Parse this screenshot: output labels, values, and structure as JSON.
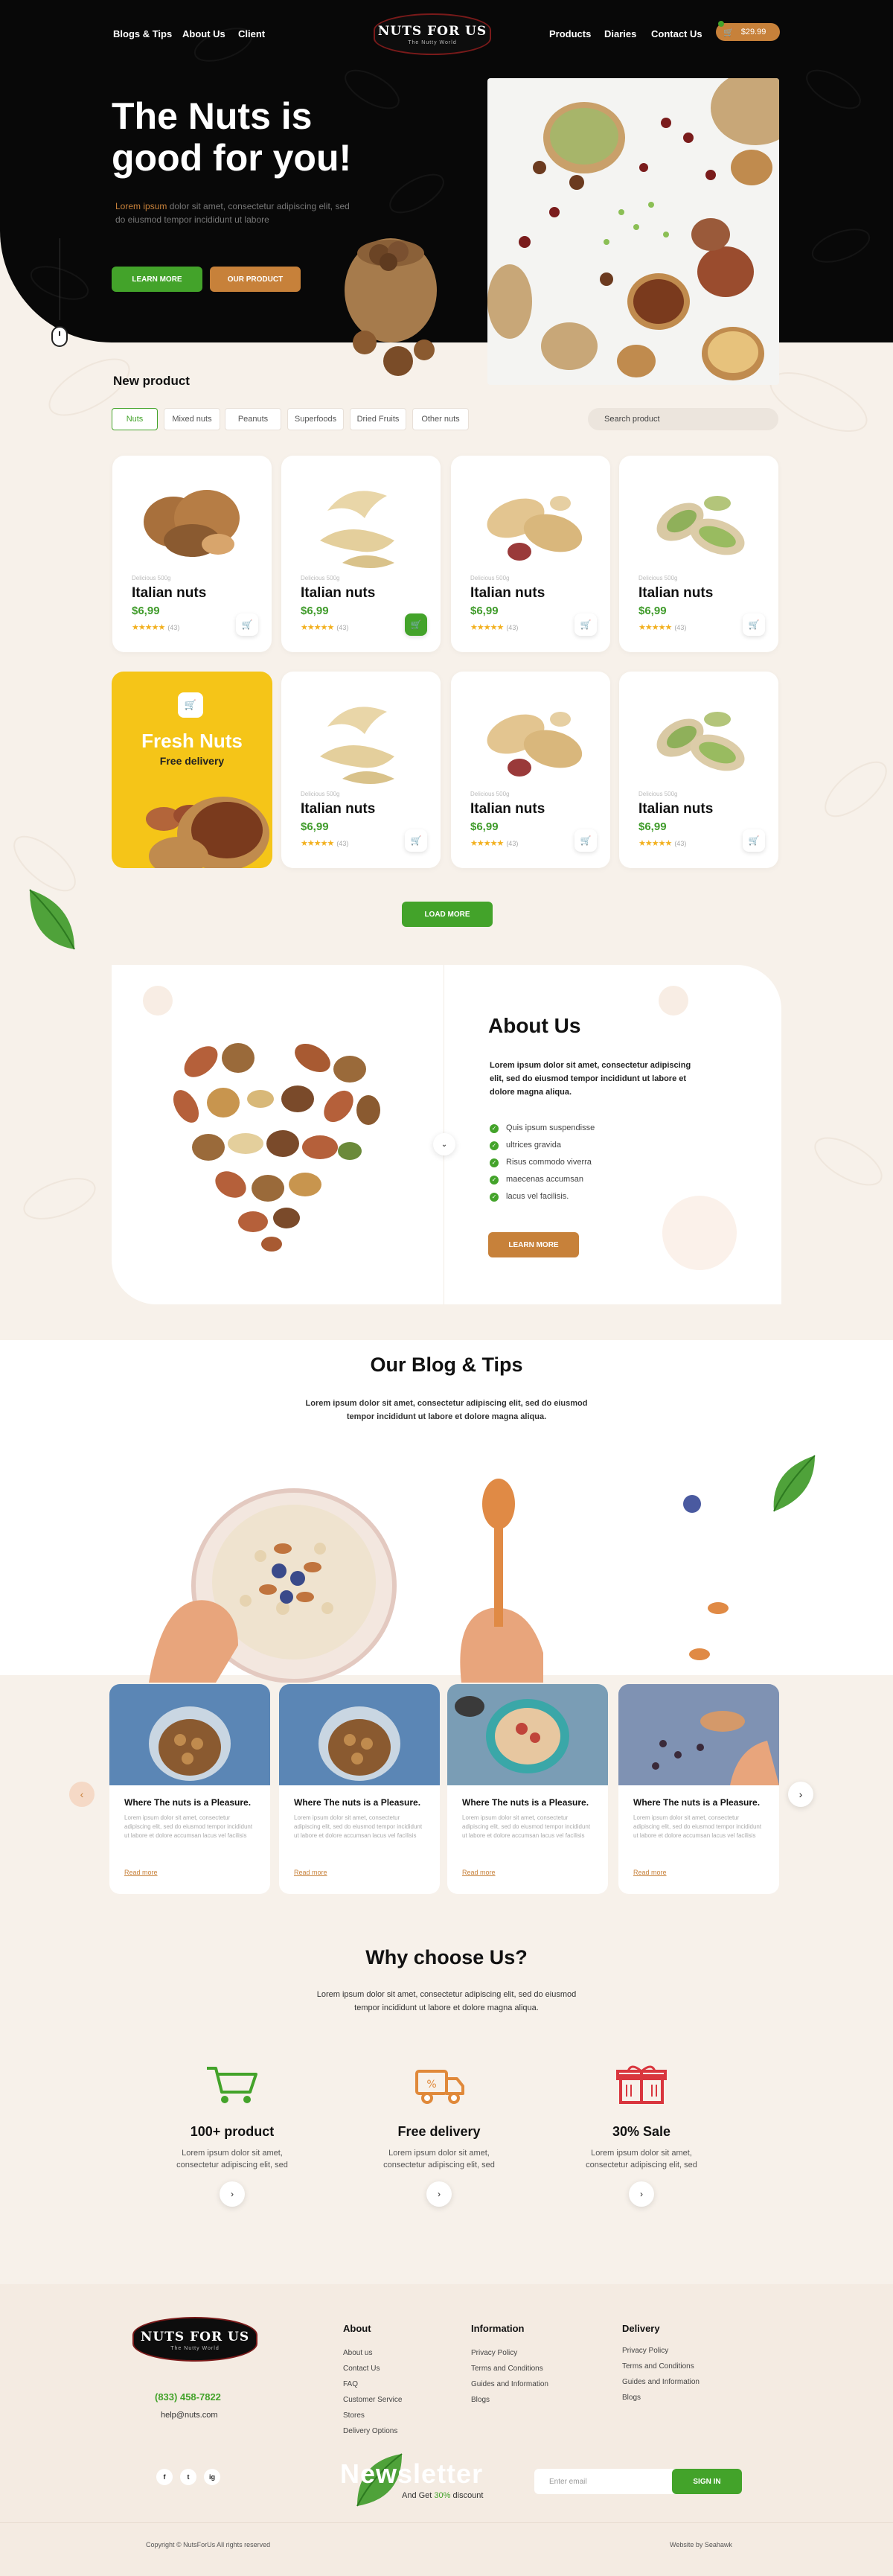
{
  "nav": {
    "left": [
      "Blogs & Tips",
      "About Us",
      "Client"
    ],
    "right": [
      "Products",
      "Diaries",
      "Contact Us"
    ],
    "logo": "NUTS FOR US",
    "logo_tagline": "The Nutty World",
    "cart_total": "$29.99"
  },
  "hero": {
    "title_line1": "The Nuts is",
    "title_line2": "good for you!",
    "desc_highlight": "Lorem ipsum",
    "desc_rest": " dolor sit amet, consectetur adipiscing elit, sed",
    "desc_line2": "do eiusmod tempor incididunt ut labore",
    "btn_learn": "LEARN MORE",
    "btn_product": "OUR PRODUCT"
  },
  "products": {
    "heading": "New product",
    "tabs": [
      "Nuts",
      "Mixed nuts",
      "Peanuts",
      "Superfoods",
      "Dried Fruits",
      "Other nuts"
    ],
    "active_tab": "Nuts",
    "search_placeholder": "Search product",
    "items": [
      {
        "weight": "Delicious 500g",
        "name": "Italian nuts",
        "price": "$6,99",
        "stars": "★★★★★",
        "reviews": "(43)",
        "img": "walnut"
      },
      {
        "weight": "Delicious 500g",
        "name": "Italian nuts",
        "price": "$6,99",
        "stars": "★★★★★",
        "reviews": "(43)",
        "img": "cashew"
      },
      {
        "weight": "Delicious 500g",
        "name": "Italian nuts",
        "price": "$6,99",
        "stars": "★★★★★",
        "reviews": "(43)",
        "img": "peanut"
      },
      {
        "weight": "Delicious 500g",
        "name": "Italian nuts",
        "price": "$6,99",
        "stars": "★★★★★",
        "reviews": "(43)",
        "img": "pistachio"
      },
      {
        "weight": "Delicious 500g",
        "name": "Italian nuts",
        "price": "$6,99",
        "stars": "★★★★★",
        "reviews": "(43)",
        "img": "cashew"
      },
      {
        "weight": "Delicious 500g",
        "name": "Italian nuts",
        "price": "$6,99",
        "stars": "★★★★★",
        "reviews": "(43)",
        "img": "peanut"
      },
      {
        "weight": "Delicious 500g",
        "name": "Italian nuts",
        "price": "$6,99",
        "stars": "★★★★★",
        "reviews": "(43)",
        "img": "pistachio"
      }
    ],
    "promo_title": "Fresh Nuts",
    "promo_sub": "Free delivery",
    "load_more": "LOAD MORE",
    "colors": {
      "green": "#43a32a",
      "brown": "#c7813a",
      "promo": "#f5c518"
    }
  },
  "about": {
    "title": "About Us",
    "desc": "Lorem ipsum dolor sit amet, consectetur adipiscing elit, sed do eiusmod tempor incididunt ut labore et dolore magna aliqua.",
    "list": [
      "Quis ipsum suspendisse",
      "ultrices gravida",
      "Risus commodo viverra",
      "maecenas accumsan",
      "lacus vel facilisis."
    ],
    "btn": "LEARN MORE"
  },
  "blog": {
    "title": "Our Blog & Tips",
    "desc_line1": "Lorem ipsum dolor sit amet, consectetur adipiscing elit, sed do eiusmod",
    "desc_line2": "tempor incididunt ut labore et dolore magna aliqua.",
    "posts": [
      {
        "title": "Where The nuts is a Pleasure.",
        "text": "Lorem ipsum dolor sit amet, consectetur adipiscing elit, sed do eiusmod tempor incididunt ut labore et dolore accumsan lacus vel facilisis",
        "link": "Read more"
      },
      {
        "title": "Where The nuts is a Pleasure.",
        "text": "Lorem ipsum dolor sit amet, consectetur adipiscing elit, sed do eiusmod tempor incididunt ut labore et dolore accumsan lacus vel facilisis",
        "link": "Read more"
      },
      {
        "title": "Where The nuts is a Pleasure.",
        "text": "Lorem ipsum dolor sit amet, consectetur adipiscing elit, sed do eiusmod tempor incididunt ut labore et dolore accumsan lacus vel facilisis",
        "link": "Read more"
      },
      {
        "title": "Where The nuts is a Pleasure.",
        "text": "Lorem ipsum dolor sit amet, consectetur adipiscing elit, sed do eiusmod tempor incididunt ut labore et dolore accumsan lacus vel facilisis",
        "link": "Read more"
      }
    ]
  },
  "why": {
    "title": "Why choose Us?",
    "desc_line1": "Lorem ipsum dolor sit amet, consectetur adipiscing elit, sed do eiusmod",
    "desc_line2": "tempor incididunt ut labore et dolore magna aliqua.",
    "items": [
      {
        "title": "100+ product",
        "text_line1": "Lorem ipsum dolor sit amet,",
        "text_line2": "consectetur adipiscing elit, sed",
        "icon": "cart-icon"
      },
      {
        "title": "Free delivery",
        "text_line1": "Lorem ipsum dolor sit amet,",
        "text_line2": "consectetur adipiscing elit, sed",
        "icon": "truck-icon"
      },
      {
        "title": "30% Sale",
        "text_line1": "Lorem ipsum dolor sit amet,",
        "text_line2": "consectetur adipiscing elit, sed",
        "icon": "gift-icon"
      }
    ]
  },
  "footer": {
    "phone": "(833) 458-7822",
    "email": "help@nuts.com",
    "cols": [
      {
        "title": "About",
        "links": [
          "About us",
          "Contact Us",
          "FAQ",
          "Customer Service",
          "Stores",
          "Delivery Options"
        ]
      },
      {
        "title": "Information",
        "links": [
          "Privacy Policy",
          "Terms and Conditions",
          "Guides and Information",
          "Blogs"
        ]
      },
      {
        "title": "Delivery",
        "links": [
          "Privacy Policy",
          "Terms and Conditions",
          "Guides and Information",
          "Blogs"
        ]
      }
    ],
    "social": [
      "f",
      "t",
      "ig"
    ],
    "newsletter_title": "Newsletter",
    "newsletter_sub_pre": "And Get ",
    "newsletter_sub_pct": "30%",
    "newsletter_sub_post": " discount",
    "email_placeholder": "Enter email",
    "signin": "SIGN IN",
    "copyright": "Copyright © NutsForUs All rights reserved",
    "credit": "Website by Seahawk"
  }
}
